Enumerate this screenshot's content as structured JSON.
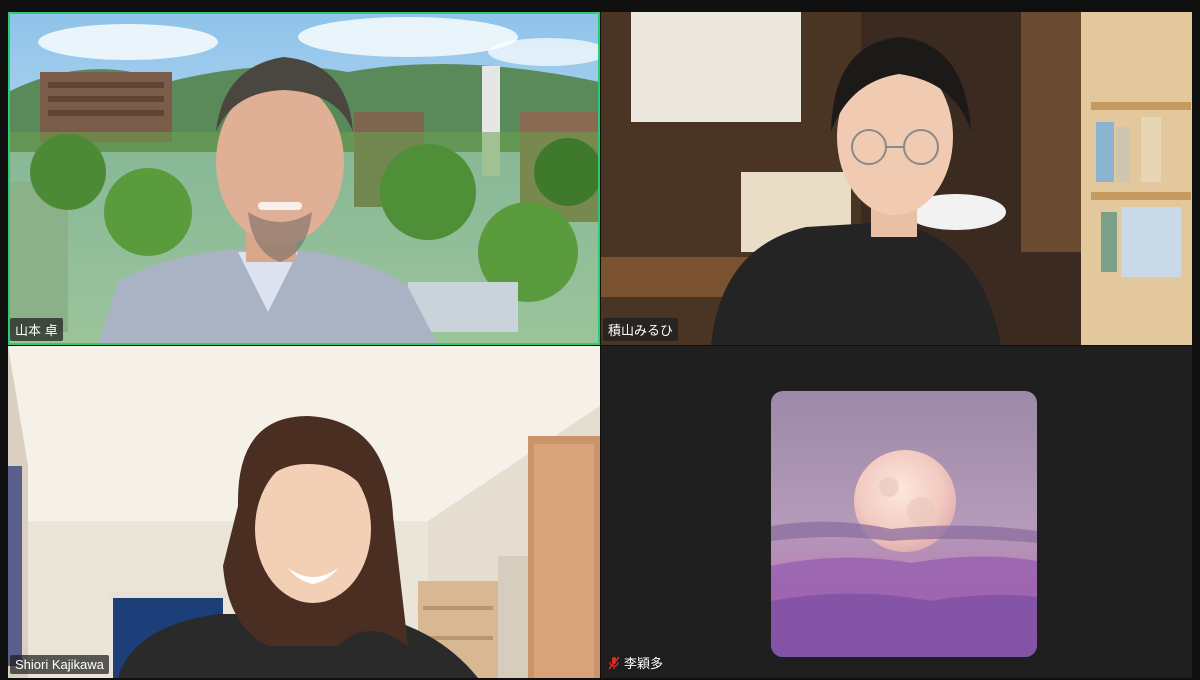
{
  "participants": [
    {
      "name": "山本 卓",
      "active_speaker": true,
      "muted": false,
      "video": "campus background with man"
    },
    {
      "name": "積山みるひ",
      "active_speaker": false,
      "muted": false,
      "video": "woman with glasses in room"
    },
    {
      "name": "Shiori Kajikawa",
      "active_speaker": false,
      "muted": false,
      "video": "smiling woman in dorm room"
    },
    {
      "name": "李穎多",
      "active_speaker": false,
      "muted": true,
      "video": "off",
      "avatar": "full-moon-image"
    }
  ],
  "colors": {
    "active_border": "#2ecc71",
    "mute_icon": "#e02828",
    "background": "#0f0f0f"
  }
}
